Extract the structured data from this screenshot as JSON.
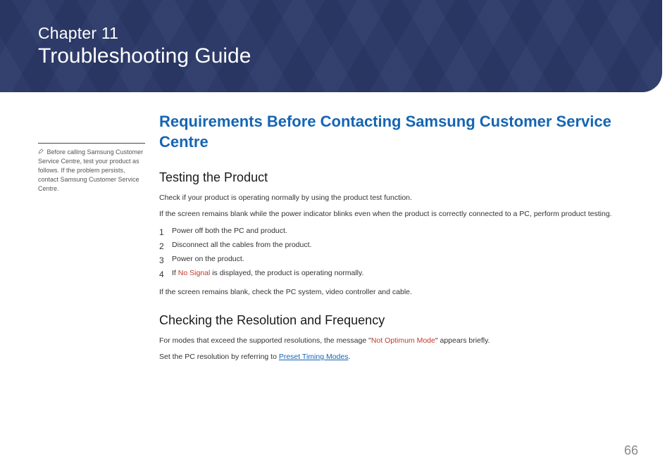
{
  "header": {
    "chapter": "Chapter 11",
    "title": "Troubleshooting Guide"
  },
  "sidebar": {
    "note": "Before calling Samsung Customer Service Centre, test your product as follows. If the problem persists, contact Samsung Customer Service Centre."
  },
  "section_heading": "Requirements Before Contacting Samsung Customer Service Centre",
  "testing": {
    "heading": "Testing the Product",
    "p1": "Check if your product is operating normally by using the product test function.",
    "p2": "If the screen remains blank while the power indicator blinks even when the product is correctly connected to a PC, perform product testing.",
    "steps": [
      "Power off both the PC and product.",
      "Disconnect all the cables from the product.",
      "Power on the product."
    ],
    "step4_prefix": "If ",
    "step4_red": "No Signal",
    "step4_suffix": " is displayed, the product is operating normally.",
    "p3": "If the screen remains blank, check the PC system, video controller and cable."
  },
  "resolution": {
    "heading": "Checking the Resolution and Frequency",
    "p1_prefix": "For modes that exceed the supported resolutions, the message \"",
    "p1_red": "Not Optimum Mode",
    "p1_suffix": "\" appears briefly.",
    "p2_prefix": "Set the PC resolution by referring to ",
    "p2_link": "Preset Timing Modes",
    "p2_suffix": "."
  },
  "page_number": "66"
}
